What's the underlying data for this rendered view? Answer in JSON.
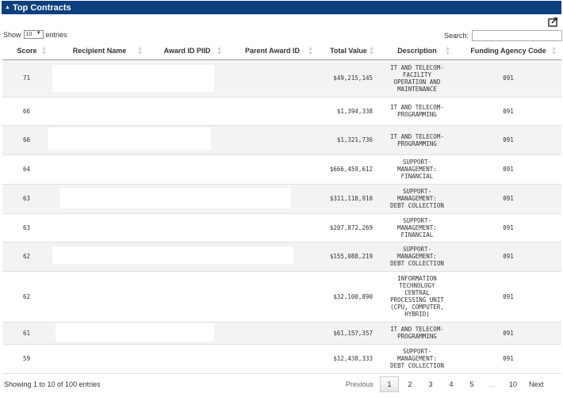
{
  "panel": {
    "title": "Top Contracts",
    "caret": "▲"
  },
  "controls": {
    "show_label": "Show",
    "entries_value": "10",
    "entries_label": "entries",
    "search_label": "Search:",
    "search_value": ""
  },
  "table": {
    "columns": [
      "Score",
      "Recipient Name",
      "Award ID PIID",
      "Parent Award ID",
      "Total Value",
      "Description",
      "Funding Agency Code"
    ],
    "rows": [
      {
        "score": "71",
        "recipient": "",
        "piid": "",
        "parent": "",
        "value": "$49,215,145",
        "desc": "IT AND TELECOM-\nFACILITY\nOPERATION AND\nMAINTENANCE",
        "agency": "091"
      },
      {
        "score": "66",
        "recipient": "",
        "piid": "",
        "parent": "",
        "value": "$1,394,338",
        "desc": "IT AND TELECOM-\nPROGRAMMING",
        "agency": "091"
      },
      {
        "score": "66",
        "recipient": "",
        "piid": "",
        "parent": "",
        "value": "$1,321,736",
        "desc": "IT AND TELECOM-\nPROGRAMMING",
        "agency": "091"
      },
      {
        "score": "64",
        "recipient": "",
        "piid": "",
        "parent": "",
        "value": "$666,459,612",
        "desc": "SUPPORT-\nMANAGEMENT:\nFINANCIAL",
        "agency": "091"
      },
      {
        "score": "63",
        "recipient": "",
        "piid": "",
        "parent": "",
        "value": "$311,118,910",
        "desc": "SUPPORT-\nMANAGEMENT:\nDEBT COLLECTION",
        "agency": "091"
      },
      {
        "score": "63",
        "recipient": "",
        "piid": "",
        "parent": "",
        "value": "$207,872,269",
        "desc": "SUPPORT-\nMANAGEMENT:\nFINANCIAL",
        "agency": "091"
      },
      {
        "score": "62",
        "recipient": "",
        "piid": "",
        "parent": "",
        "value": "$155,088,219",
        "desc": "SUPPORT-\nMANAGEMENT:\nDEBT COLLECTION",
        "agency": "091"
      },
      {
        "score": "62",
        "recipient": "",
        "piid": "",
        "parent": "",
        "value": "$32,100,890",
        "desc": "INFORMATION\nTECHNOLOGY\nCENTRAL\nPROCESSING UNIT\n(CPU, COMPUTER,\nHYBRID)",
        "agency": "091"
      },
      {
        "score": "61",
        "recipient": "",
        "piid": "",
        "parent": "",
        "value": "$61,157,357",
        "desc": "IT AND TELECOM-\nPROGRAMMING",
        "agency": "091"
      },
      {
        "score": "59",
        "recipient": "",
        "piid": "",
        "parent": "",
        "value": "$12,438,333",
        "desc": "SUPPORT-\nMANAGEMENT:\nDEBT COLLECTION",
        "agency": "091"
      }
    ]
  },
  "footer": {
    "info": "Showing 1 to 10 of 100 entries",
    "previous": "Previous",
    "pages": [
      "1",
      "2",
      "3",
      "4",
      "5",
      "…",
      "10"
    ],
    "active_page": "1",
    "next": "Next"
  },
  "colors": {
    "header_bg": "#0c3f7e",
    "stripe": "#f3f3f3"
  },
  "icons": {
    "export": "export-share-icon",
    "sort": "sort-both-icon",
    "caret": "collapse-caret-icon"
  }
}
